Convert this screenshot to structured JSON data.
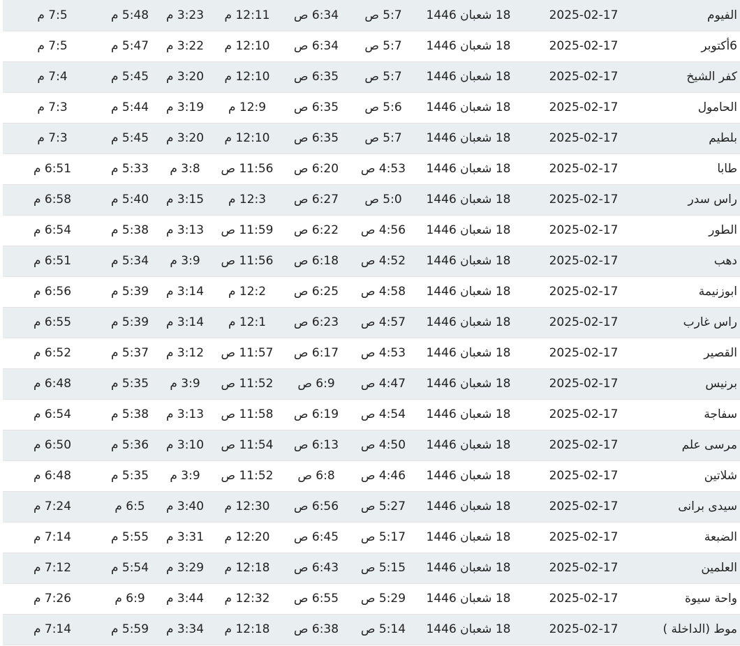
{
  "rows": [
    {
      "city": "الفيوم",
      "date": "2025-02-17",
      "hijri": "18 شعبان 1446",
      "fajr": "5:7 ص",
      "sunrise": "6:34 ص",
      "dhuhr": "12:11 م",
      "asr": "3:23 م",
      "maghrib": "5:48 م",
      "isha": "7:5 م"
    },
    {
      "city": "6أكتوبر",
      "date": "2025-02-17",
      "hijri": "18 شعبان 1446",
      "fajr": "5:7 ص",
      "sunrise": "6:34 ص",
      "dhuhr": "12:10 م",
      "asr": "3:22 م",
      "maghrib": "5:47 م",
      "isha": "7:5 م"
    },
    {
      "city": "كفر الشيخ",
      "date": "2025-02-17",
      "hijri": "18 شعبان 1446",
      "fajr": "5:7 ص",
      "sunrise": "6:35 ص",
      "dhuhr": "12:10 م",
      "asr": "3:20 م",
      "maghrib": "5:45 م",
      "isha": "7:4 م"
    },
    {
      "city": "الحامول",
      "date": "2025-02-17",
      "hijri": "18 شعبان 1446",
      "fajr": "5:6 ص",
      "sunrise": "6:35 ص",
      "dhuhr": "12:9 م",
      "asr": "3:19 م",
      "maghrib": "5:44 م",
      "isha": "7:3 م"
    },
    {
      "city": "بلطيم",
      "date": "2025-02-17",
      "hijri": "18 شعبان 1446",
      "fajr": "5:7 ص",
      "sunrise": "6:35 ص",
      "dhuhr": "12:10 م",
      "asr": "3:20 م",
      "maghrib": "5:45 م",
      "isha": "7:3 م"
    },
    {
      "city": "طابا",
      "date": "2025-02-17",
      "hijri": "18 شعبان 1446",
      "fajr": "4:53 ص",
      "sunrise": "6:20 ص",
      "dhuhr": "11:56 ص",
      "asr": "3:8 م",
      "maghrib": "5:33 م",
      "isha": "6:51 م"
    },
    {
      "city": "راس سدر",
      "date": "2025-02-17",
      "hijri": "18 شعبان 1446",
      "fajr": "5:0 ص",
      "sunrise": "6:27 ص",
      "dhuhr": "12:3 م",
      "asr": "3:15 م",
      "maghrib": "5:40 م",
      "isha": "6:58 م"
    },
    {
      "city": "الطور",
      "date": "2025-02-17",
      "hijri": "18 شعبان 1446",
      "fajr": "4:56 ص",
      "sunrise": "6:22 ص",
      "dhuhr": "11:59 ص",
      "asr": "3:13 م",
      "maghrib": "5:38 م",
      "isha": "6:54 م"
    },
    {
      "city": "دهب",
      "date": "2025-02-17",
      "hijri": "18 شعبان 1446",
      "fajr": "4:52 ص",
      "sunrise": "6:18 ص",
      "dhuhr": "11:56 ص",
      "asr": "3:9 م",
      "maghrib": "5:34 م",
      "isha": "6:51 م"
    },
    {
      "city": "ابوزنيمة",
      "date": "2025-02-17",
      "hijri": "18 شعبان 1446",
      "fajr": "4:58 ص",
      "sunrise": "6:25 ص",
      "dhuhr": "12:2 م",
      "asr": "3:14 م",
      "maghrib": "5:39 م",
      "isha": "6:56 م"
    },
    {
      "city": "راس غارب",
      "date": "2025-02-17",
      "hijri": "18 شعبان 1446",
      "fajr": "4:57 ص",
      "sunrise": "6:23 ص",
      "dhuhr": "12:1 م",
      "asr": "3:14 م",
      "maghrib": "5:39 م",
      "isha": "6:55 م"
    },
    {
      "city": "القصير",
      "date": "2025-02-17",
      "hijri": "18 شعبان 1446",
      "fajr": "4:53 ص",
      "sunrise": "6:17 ص",
      "dhuhr": "11:57 ص",
      "asr": "3:12 م",
      "maghrib": "5:37 م",
      "isha": "6:52 م"
    },
    {
      "city": "برنيس",
      "date": "2025-02-17",
      "hijri": "18 شعبان 1446",
      "fajr": "4:47 ص",
      "sunrise": "6:9 ص",
      "dhuhr": "11:52 ص",
      "asr": "3:9 م",
      "maghrib": "5:35 م",
      "isha": "6:48 م"
    },
    {
      "city": "سفاجة",
      "date": "2025-02-17",
      "hijri": "18 شعبان 1446",
      "fajr": "4:54 ص",
      "sunrise": "6:19 ص",
      "dhuhr": "11:58 ص",
      "asr": "3:13 م",
      "maghrib": "5:38 م",
      "isha": "6:54 م"
    },
    {
      "city": "مرسى علم",
      "date": "2025-02-17",
      "hijri": "18 شعبان 1446",
      "fajr": "4:50 ص",
      "sunrise": "6:13 ص",
      "dhuhr": "11:54 ص",
      "asr": "3:10 م",
      "maghrib": "5:36 م",
      "isha": "6:50 م"
    },
    {
      "city": "شلاتين",
      "date": "2025-02-17",
      "hijri": "18 شعبان 1446",
      "fajr": "4:46 ص",
      "sunrise": "6:8 ص",
      "dhuhr": "11:52 ص",
      "asr": "3:9 م",
      "maghrib": "5:35 م",
      "isha": "6:48 م"
    },
    {
      "city": "سيدى برانى",
      "date": "2025-02-17",
      "hijri": "18 شعبان 1446",
      "fajr": "5:27 ص",
      "sunrise": "6:56 ص",
      "dhuhr": "12:30 م",
      "asr": "3:40 م",
      "maghrib": "6:5 م",
      "isha": "7:24 م"
    },
    {
      "city": "الضبعة",
      "date": "2025-02-17",
      "hijri": "18 شعبان 1446",
      "fajr": "5:17 ص",
      "sunrise": "6:45 ص",
      "dhuhr": "12:20 م",
      "asr": "3:31 م",
      "maghrib": "5:55 م",
      "isha": "7:14 م"
    },
    {
      "city": "العلمين",
      "date": "2025-02-17",
      "hijri": "18 شعبان 1446",
      "fajr": "5:15 ص",
      "sunrise": "6:43 ص",
      "dhuhr": "12:18 م",
      "asr": "3:29 م",
      "maghrib": "5:54 م",
      "isha": "7:12 م"
    },
    {
      "city": "واحة سيوة",
      "date": "2025-02-17",
      "hijri": "18 شعبان 1446",
      "fajr": "5:29 ص",
      "sunrise": "6:55 ص",
      "dhuhr": "12:32 م",
      "asr": "3:44 م",
      "maghrib": "6:9 م",
      "isha": "7:26 م"
    },
    {
      "city": "موط (الداخلة )",
      "date": "2025-02-17",
      "hijri": "18 شعبان 1446",
      "fajr": "5:14 ص",
      "sunrise": "6:38 ص",
      "dhuhr": "12:18 م",
      "asr": "3:34 م",
      "maghrib": "5:59 م",
      "isha": "7:14 م"
    }
  ]
}
